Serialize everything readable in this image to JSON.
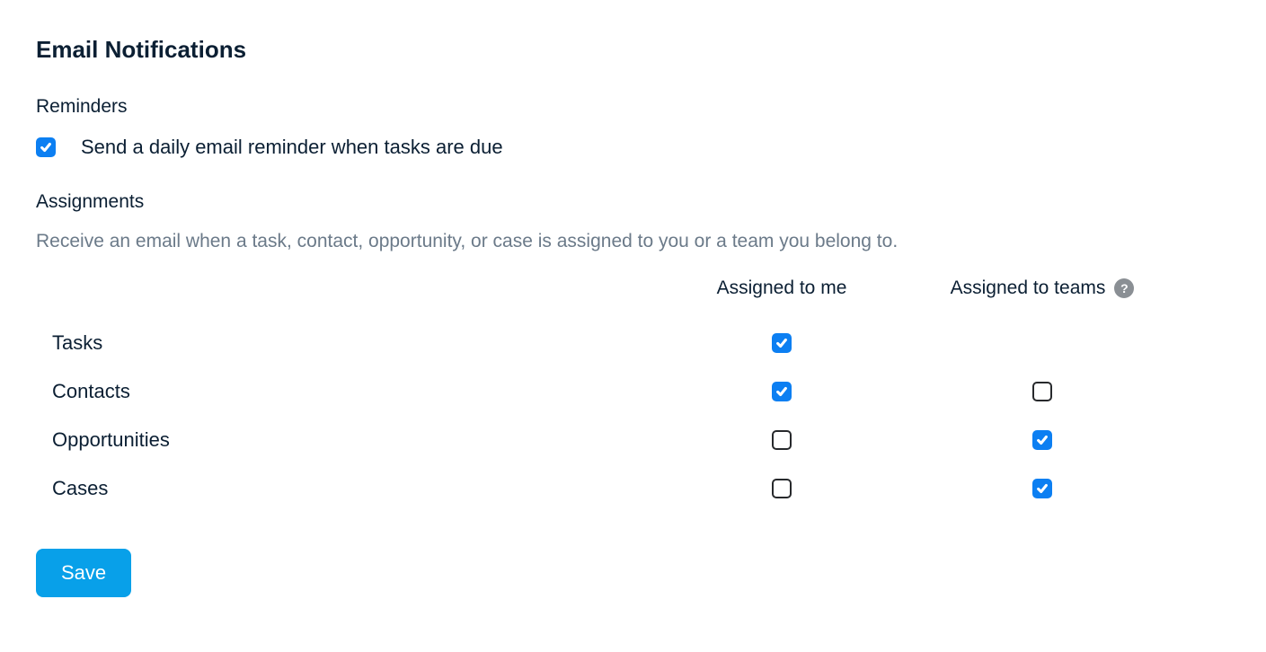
{
  "page": {
    "title": "Email Notifications"
  },
  "reminders": {
    "header": "Reminders",
    "daily_email_label": "Send a daily email reminder when tasks are due",
    "daily_email_checked": true
  },
  "assignments": {
    "header": "Assignments",
    "description": "Receive an email when a task, contact, opportunity, or case is assigned to you or a team you belong to.",
    "columns": {
      "assigned_to_me": "Assigned to me",
      "assigned_to_teams": "Assigned to teams"
    },
    "rows": [
      {
        "label": "Tasks",
        "assigned_to_me": true,
        "assigned_to_teams": null
      },
      {
        "label": "Contacts",
        "assigned_to_me": true,
        "assigned_to_teams": false
      },
      {
        "label": "Opportunities",
        "assigned_to_me": false,
        "assigned_to_teams": true
      },
      {
        "label": "Cases",
        "assigned_to_me": false,
        "assigned_to_teams": true
      }
    ]
  },
  "actions": {
    "save_label": "Save"
  },
  "help_icon_text": "?"
}
